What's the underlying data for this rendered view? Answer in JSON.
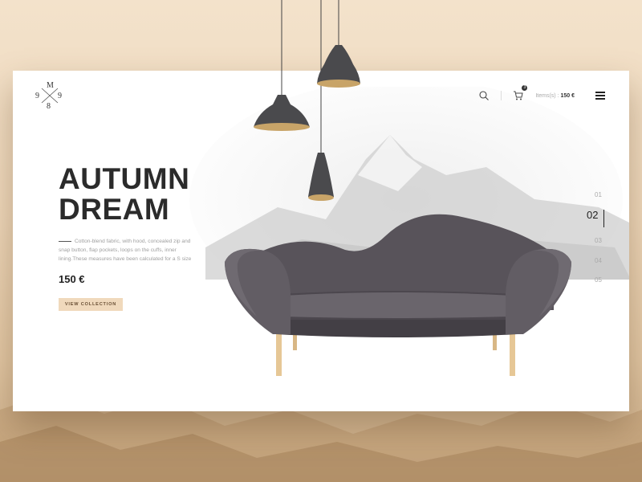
{
  "logo": {
    "top": "M",
    "left": "9",
    "right": "9",
    "bottom": "8"
  },
  "header": {
    "items_label": "Items(s) :",
    "items_value": "150 €",
    "cart_count": "3"
  },
  "hero": {
    "title_line1": "AUTUMN",
    "title_line2": "DREAM",
    "description": "Cotton-blend fabric, with hood, concealed zip and snap button, flap pockets, loops on the cuffs, inner lining.These measures have been calculated for a S size",
    "price": "150 €",
    "cta_label": "VIEW COLLECTION"
  },
  "pager": {
    "items": [
      "01",
      "02",
      "03",
      "04",
      "05"
    ],
    "active": "02"
  },
  "colors": {
    "accent": "#f0d9bc",
    "text": "#2b2b2b",
    "sofa": "#5d585e",
    "lamp_inner": "#c8a468"
  },
  "icons": [
    "search-icon",
    "cart-icon",
    "menu-icon",
    "pendant-lamp-icon"
  ]
}
